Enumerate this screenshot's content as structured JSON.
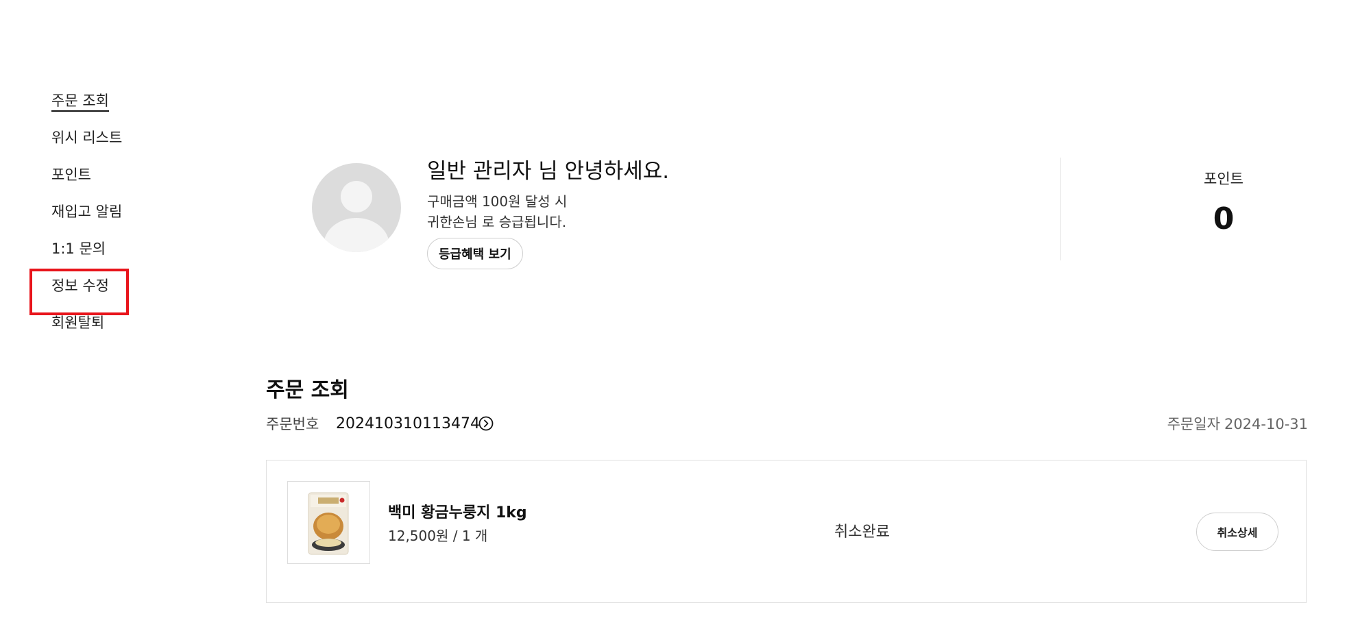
{
  "sidebar": {
    "items": [
      {
        "label": "주문 조회",
        "active": true
      },
      {
        "label": "위시 리스트"
      },
      {
        "label": "포인트"
      },
      {
        "label": "재입고 알림"
      },
      {
        "label": "1:1 문의"
      },
      {
        "label": "정보 수정",
        "highlighted": true
      },
      {
        "label": "회원탈퇴"
      }
    ]
  },
  "profile": {
    "greeting": "일반 관리자 님 안녕하세요.",
    "grade_line_1": "구매금액 100원 달성 시",
    "grade_line_2": "귀한손님 로 승급됩니다.",
    "grade_button_label": "등급혜택 보기",
    "points_label": "포인트",
    "points_value": "0"
  },
  "orders": {
    "title": "주문 조회",
    "order_number_label": "주문번호",
    "order_number": "202410310113474",
    "order_date_label": "주문일자",
    "order_date": "2024-10-31",
    "items": [
      {
        "name": "백미 황금누룽지 1kg",
        "price_qty": "12,500원 / 1 개",
        "status": "취소완료",
        "action_label": "취소상세"
      }
    ]
  },
  "colors": {
    "highlight": "#e8141b",
    "text": "#111111",
    "muted": "#666666",
    "border": "#e0e0e0"
  },
  "icons": {
    "order_link": "circle-chevron-right-icon",
    "avatar": "default-user-avatar"
  }
}
